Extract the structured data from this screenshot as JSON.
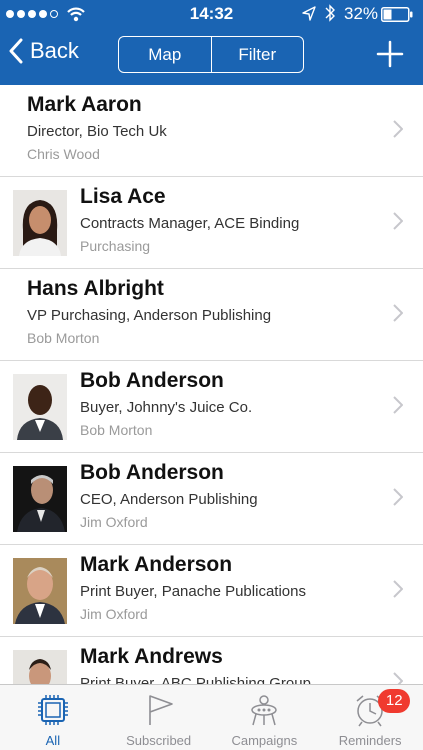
{
  "status_bar": {
    "time": "14:32",
    "battery": "32%",
    "signal_dots_filled": 4,
    "signal_dots_total": 5
  },
  "nav": {
    "back_label": "Back",
    "segments": [
      "Map",
      "Filter"
    ],
    "add_icon": "plus-icon"
  },
  "contacts": [
    {
      "name": "Mark Aaron",
      "title": "Director, Bio Tech Uk",
      "owner": "Chris Wood",
      "has_photo": false
    },
    {
      "name": "Lisa Ace",
      "title": "Contracts Manager, ACE Binding",
      "owner": "Purchasing",
      "has_photo": true
    },
    {
      "name": "Hans Albright",
      "title": "VP Purchasing, Anderson Publishing",
      "owner": "Bob Morton",
      "has_photo": false
    },
    {
      "name": "Bob Anderson",
      "title": "Buyer, Johnny's Juice Co.",
      "owner": "Bob Morton",
      "has_photo": true
    },
    {
      "name": "Bob Anderson",
      "title": "CEO, Anderson Publishing",
      "owner": "Jim Oxford",
      "has_photo": true
    },
    {
      "name": "Mark Anderson",
      "title": "Print Buyer, Panache Publications",
      "owner": "Jim Oxford",
      "has_photo": true
    },
    {
      "name": "Mark Andrews",
      "title": "Print Buyer, ABC Publishing Group",
      "owner": "",
      "has_photo": true
    }
  ],
  "tabs": [
    {
      "label": "All",
      "icon": "chip-icon",
      "active": true
    },
    {
      "label": "Subscribed",
      "icon": "flag-icon",
      "active": false
    },
    {
      "label": "Campaigns",
      "icon": "campaign-icon",
      "active": false
    },
    {
      "label": "Reminders",
      "icon": "alarm-clock-icon",
      "active": false,
      "badge": "12"
    }
  ],
  "colors": {
    "nav_background": "#1a64b3",
    "badge": "#f03a2f",
    "active_tab": "#1a64b3",
    "inactive_tab": "#8e8e93"
  }
}
